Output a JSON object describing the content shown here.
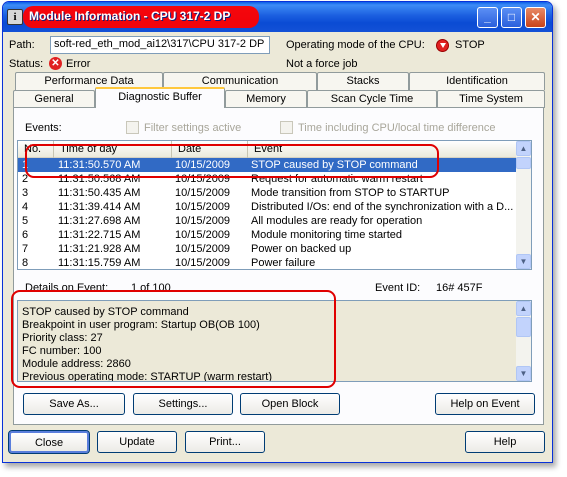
{
  "window": {
    "title": "Module Information - CPU 317-2 DP",
    "minimize_glyph": "_",
    "maximize_glyph": "□",
    "close_glyph": "✕",
    "icon_glyph": "i"
  },
  "header": {
    "path_label": "Path:",
    "path_value": "soft-red_eth_mod_ai12\\317\\CPU 317-2 DP",
    "status_label": "Status:",
    "status_value": "Error",
    "operating_mode_label": "Operating mode of the  CPU:",
    "operating_mode_value": "STOP",
    "force_job_text": "Not a force job"
  },
  "tabs": {
    "row1": [
      "Performance Data",
      "Communication",
      "Stacks",
      "Identification"
    ],
    "row2": [
      "General",
      "Diagnostic Buffer",
      "Memory",
      "Scan Cycle Time",
      "Time System"
    ],
    "active": "Diagnostic Buffer"
  },
  "events": {
    "label": "Events:",
    "filter_checkbox_label": "Filter settings active",
    "time_checkbox_label": "Time including CPU/local time difference",
    "columns": [
      "No.",
      "Time of day",
      "Date",
      "Event"
    ],
    "rows": [
      [
        "1",
        "11:31:50.570 AM",
        "10/15/2009",
        "STOP caused by STOP command"
      ],
      [
        "2",
        "11:31:50.568 AM",
        "10/15/2009",
        "Request for automatic warm restart"
      ],
      [
        "3",
        "11:31:50.435 AM",
        "10/15/2009",
        "Mode transition from STOP to STARTUP"
      ],
      [
        "4",
        "11:31:39.414 AM",
        "10/15/2009",
        "Distributed I/Os: end of the synchronization with a D..."
      ],
      [
        "5",
        "11:31:27.698 AM",
        "10/15/2009",
        "All modules are ready for operation"
      ],
      [
        "6",
        "11:31:22.715 AM",
        "10/15/2009",
        "Module monitoring time started"
      ],
      [
        "7",
        "11:31:21.928 AM",
        "10/15/2009",
        "Power on backed up"
      ],
      [
        "8",
        "11:31:15.759 AM",
        "10/15/2009",
        "Power failure"
      ]
    ],
    "selected_index": 0
  },
  "details": {
    "label": "Details on Event:",
    "count": "1  of 100",
    "event_id_label": "Event ID:",
    "event_id_value": "16# 457F",
    "lines": [
      "STOP caused by STOP command",
      "Breakpoint in user program: Startup OB(OB 100)",
      "Priority class:   27",
      "FC number:    100",
      "Module address:    2860",
      "Previous operating mode: STARTUP (warm restart)"
    ]
  },
  "panel_buttons": {
    "save_as": "Save As...",
    "settings": "Settings...",
    "open_block": "Open Block",
    "help_on_event": "Help on Event"
  },
  "footer_buttons": {
    "close": "Close",
    "update": "Update",
    "print": "Print...",
    "help": "Help"
  },
  "colors": {
    "selection": "#316ac5",
    "annotation": "#e00000",
    "titlebar": "#0a4bd4"
  }
}
